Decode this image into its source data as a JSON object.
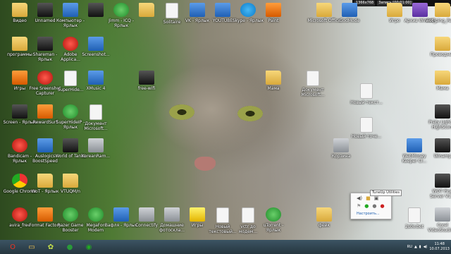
{
  "timebar": {
    "resolution": "1366x768",
    "rec": "Запись [00:01:00]"
  },
  "desktop_icons": [
    {
      "label": "Видео",
      "color": "folder"
    },
    {
      "label": "Unnamed",
      "color": "dark"
    },
    {
      "label": "Компьютер - Ярлык",
      "color": "blue"
    },
    {
      "label": "",
      "color": "dark"
    },
    {
      "label": "Jimm - ICQ - Ярлык",
      "color": "green"
    },
    {
      "label": "",
      "color": "folder"
    },
    {
      "label": "Solitaire",
      "color": "doc"
    },
    {
      "label": "VK - Ярлык",
      "color": "blue"
    },
    {
      "label": "YOUTUBE",
      "color": "blue"
    },
    {
      "label": "Skype - Ярлык",
      "color": "skype"
    },
    {
      "label": "Paint",
      "color": "orange"
    },
    {
      "label": "Microsoft Office",
      "color": "folder"
    },
    {
      "label": "GodMode",
      "color": "blue"
    },
    {
      "label": "Игро",
      "color": "folder"
    },
    {
      "label": "Архив WinRAR",
      "color": "purple"
    },
    {
      "label": "wot_ping_Release",
      "color": "folder"
    },
    {
      "label": "программы",
      "color": "folder"
    },
    {
      "label": "Shareman - Ярлык",
      "color": "dark"
    },
    {
      "label": "Adobe Applica...",
      "color": "red"
    },
    {
      "label": "Screenshot...",
      "color": "blue"
    },
    {
      "label": "Игры",
      "color": "orange"
    },
    {
      "label": "Free Sreenshot Capturer",
      "color": "red"
    },
    {
      "label": "SuperHide...",
      "color": "doc"
    },
    {
      "label": "XMusic 4",
      "color": "blue"
    },
    {
      "label": "free-wifi",
      "color": "dark"
    },
    {
      "label": "Screen - Ярлык",
      "color": "dark"
    },
    {
      "label": "RewardSurf",
      "color": "orange"
    },
    {
      "label": "SuperHideIP - Ярлык",
      "color": "green"
    },
    {
      "label": "Документ Microsoft...",
      "color": "doc"
    },
    {
      "label": "Bandicam - Ярлык",
      "color": "red"
    },
    {
      "label": "Auslogics BoostSpeed",
      "color": "blue"
    },
    {
      "label": "World of Tanks",
      "color": "dark"
    },
    {
      "label": "KoreanRam...",
      "color": "gray"
    },
    {
      "label": "Google Chrome",
      "color": "chrome"
    },
    {
      "label": "WoT - Ярлык",
      "color": "folder"
    },
    {
      "label": "VTUQM/n",
      "color": "folder"
    },
    {
      "label": "avira_free",
      "color": "red"
    },
    {
      "label": "Format Factory",
      "color": "orange"
    },
    {
      "label": "Razer Game Booster",
      "color": "green"
    },
    {
      "label": "MegaFon Modem",
      "color": "green"
    },
    {
      "label": "Вафля - Ярлык",
      "color": "blue"
    },
    {
      "label": "Connectify",
      "color": "gray"
    },
    {
      "label": "Домашние фотоскла...",
      "color": "gray"
    },
    {
      "label": "Игры",
      "color": "yellow"
    },
    {
      "label": "Новый текстовый...",
      "color": "doc"
    },
    {
      "label": "vctr до модем...",
      "color": "doc"
    },
    {
      "label": "uTorrent - Ярлык",
      "color": "green"
    },
    {
      "label": "фейк",
      "color": "folder"
    },
    {
      "label": "Проводник",
      "color": "folder"
    },
    {
      "label": "Документ Microsoft...",
      "color": "doc"
    },
    {
      "label": "Новый текст...",
      "color": "doc"
    },
    {
      "label": "Новый точе...",
      "color": "doc"
    },
    {
      "label": "Корзина",
      "color": "gray"
    },
    {
      "label": "Prety Lights - HighScore",
      "color": "dark"
    },
    {
      "label": "WebMoney Keeper Cl...",
      "color": "blue"
    },
    {
      "label": "Winamp",
      "color": "dark"
    },
    {
      "label": "WOT Ping Server V1...",
      "color": "dark"
    },
    {
      "label": "2s0o.bet",
      "color": "doc"
    },
    {
      "label": "Corel VideoStudio...",
      "color": "gray"
    },
    {
      "label": "Мама",
      "color": "folder"
    },
    {
      "label": "Мама",
      "color": "folder"
    }
  ],
  "popup": {
    "tooltip": "TuneUp Utilities",
    "settings_link": "Настроить..."
  },
  "taskbar": {
    "items": [
      {
        "icon": "opera-icon",
        "glyph": "O",
        "color": "#e32"
      },
      {
        "icon": "explorer-icon",
        "glyph": "▭",
        "color": "#f3c24f"
      },
      {
        "icon": "game-icon",
        "glyph": "✿",
        "color": "#c9e24a"
      },
      {
        "icon": "megafon-icon",
        "glyph": "●",
        "color": "#2a9a3a"
      },
      {
        "icon": "chrome-icon",
        "glyph": "◉",
        "color": "#2a2"
      }
    ],
    "lang": "RU",
    "time": "11:48",
    "date": "10.07.2013"
  }
}
